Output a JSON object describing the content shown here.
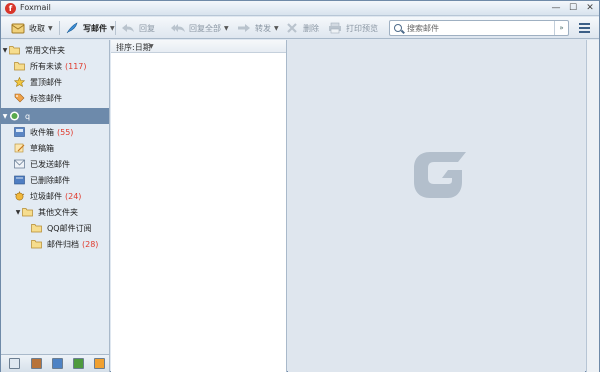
{
  "window": {
    "title": "Foxmail"
  },
  "toolbar": {
    "receive_label": "收取",
    "compose_label": "写邮件",
    "reply_label": "回复",
    "reply_all_label": "回复全部",
    "forward_label": "转发",
    "delete_label": "删除",
    "print_label": "打印预览"
  },
  "search": {
    "placeholder": "搜索邮件",
    "value": ""
  },
  "sidebar": {
    "common_folders": {
      "label": "常用文件夹",
      "items": [
        {
          "label": "所有未读",
          "count": "(117)"
        },
        {
          "label": "置顶邮件",
          "count": ""
        },
        {
          "label": "标签邮件",
          "count": ""
        }
      ]
    },
    "account": {
      "label": "q",
      "items": [
        {
          "label": "收件箱",
          "count": "(55)"
        },
        {
          "label": "草稿箱",
          "count": ""
        },
        {
          "label": "已发送邮件",
          "count": ""
        },
        {
          "label": "已删除邮件",
          "count": ""
        },
        {
          "label": "垃圾邮件",
          "count": "(24)"
        }
      ],
      "other_folders": {
        "label": "其他文件夹",
        "items": [
          {
            "label": "QQ邮件订阅",
            "count": ""
          },
          {
            "label": "邮件归档",
            "count": "(28)"
          }
        ]
      }
    }
  },
  "list": {
    "sort_label": "排序:日期"
  },
  "colors": {
    "accent": "#6d8aab",
    "count_red": "#e03a2c",
    "brand": "#d8362b"
  }
}
